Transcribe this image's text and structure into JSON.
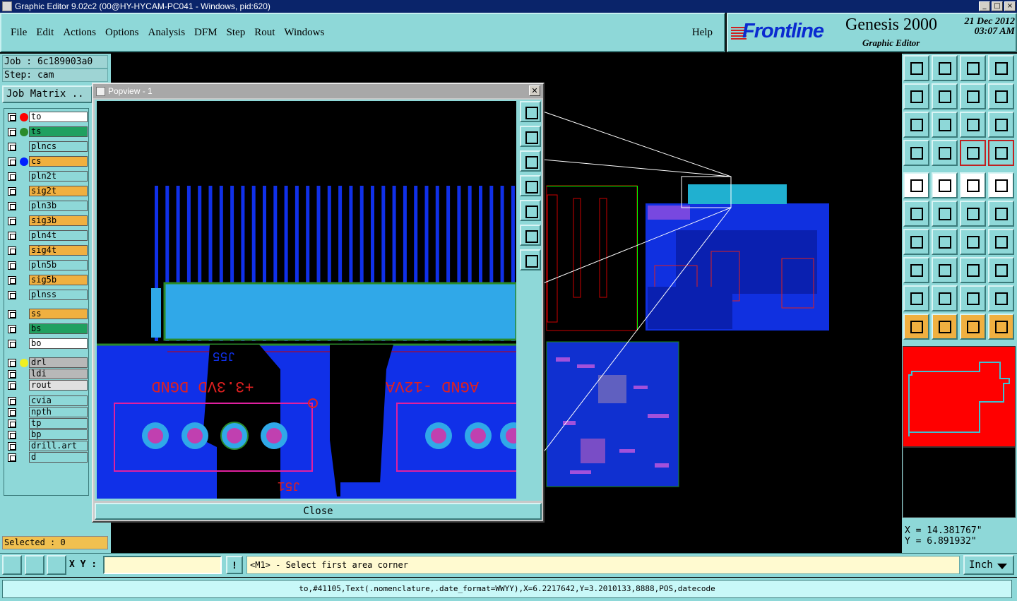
{
  "window": {
    "title": "Graphic Editor 9.02c2 (00@HY-HYCAM-PC041 - Windows, pid:620)"
  },
  "menu": {
    "items": [
      "File",
      "Edit",
      "Actions",
      "Options",
      "Analysis",
      "DFM",
      "Step",
      "Rout",
      "Windows"
    ],
    "help": "Help"
  },
  "brand": {
    "logo": "Frontline",
    "product": "Genesis 2000",
    "subtitle": "Graphic Editor",
    "date": "21 Dec 2012",
    "time": "03:07 AM"
  },
  "job": {
    "job_label": "Job : 6c189003a0",
    "step_label": "Step: cam",
    "matrix_button": "Job Matrix .."
  },
  "layers": [
    {
      "name": "to",
      "color": "#ffffff",
      "dot": "#ff0000"
    },
    {
      "name": "ts",
      "color": "#20a060",
      "dot": "#2a8a2a"
    },
    {
      "name": "plncs",
      "color": "#8ed8d8",
      "dot": ""
    },
    {
      "name": "cs",
      "color": "#f0b040",
      "dot": "#0020ff"
    },
    {
      "name": "pln2t",
      "color": "#8ed8d8",
      "dot": ""
    },
    {
      "name": "sig2t",
      "color": "#f0b040",
      "dot": ""
    },
    {
      "name": "pln3b",
      "color": "#8ed8d8",
      "dot": ""
    },
    {
      "name": "sig3b",
      "color": "#f0b040",
      "dot": ""
    },
    {
      "name": "pln4t",
      "color": "#8ed8d8",
      "dot": ""
    },
    {
      "name": "sig4t",
      "color": "#f0b040",
      "dot": ""
    },
    {
      "name": "pln5b",
      "color": "#8ed8d8",
      "dot": ""
    },
    {
      "name": "sig5b",
      "color": "#f0b040",
      "dot": ""
    },
    {
      "name": "plnss",
      "color": "#8ed8d8",
      "dot": ""
    },
    {
      "name": "ss",
      "color": "#f0b040",
      "dot": ""
    },
    {
      "name": "bs",
      "color": "#20a060",
      "dot": ""
    },
    {
      "name": "bo",
      "color": "#ffffff",
      "dot": ""
    },
    {
      "name": "drl",
      "color": "#b8b8b8",
      "dot": "#f0f020"
    },
    {
      "name": "ldi",
      "color": "#b8b8b8",
      "dot": ""
    },
    {
      "name": "rout",
      "color": "#e0e0e0",
      "dot": ""
    },
    {
      "name": "cvia",
      "color": "#8ed8d8",
      "dot": ""
    },
    {
      "name": "npth",
      "color": "#8ed8d8",
      "dot": ""
    },
    {
      "name": "tp",
      "color": "#8ed8d8",
      "dot": ""
    },
    {
      "name": "bp",
      "color": "#8ed8d8",
      "dot": ""
    },
    {
      "name": "drill.art",
      "color": "#8ed8d8",
      "dot": ""
    },
    {
      "name": "d",
      "color": "#8ed8d8",
      "dot": ""
    }
  ],
  "selected": "Selected : 0",
  "popview": {
    "title": "Popview - 1",
    "close": "Close",
    "silk_left": "+3.3VD DGND",
    "silk_right": "AGND -12VA",
    "ref_top": "J55",
    "ref_bottom": "J51"
  },
  "coords": {
    "x": "X =  14.381767\"",
    "y": "Y =   6.891932\""
  },
  "bottom": {
    "xy_label": "X Y :",
    "xy_value": "",
    "bang": "!",
    "prompt": "<M1> - Select first area corner",
    "unit": "Inch"
  },
  "status": "to,#41105,Text(.nomenclature,.date_format=WWYY),X=6.2217642,Y=3.2010133,8888,POS,datecode"
}
